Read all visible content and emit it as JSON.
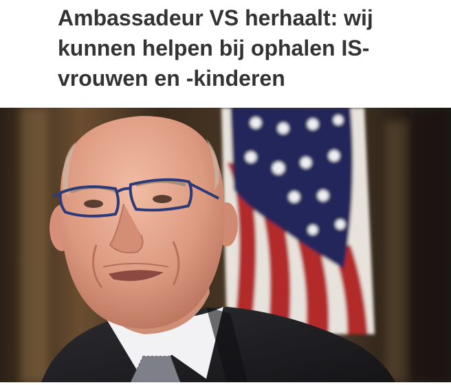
{
  "article": {
    "headline_lines": [
      "Ambassadeur VS herhaalt: wij",
      "kunnen helpen bij ophalen IS-",
      "vrouwen en -kinderen"
    ]
  },
  "photo": {
    "subject": "man-with-glasses-before-us-flag",
    "colors": {
      "background_dark": "#2e2418",
      "background_warm": "#7a5a38",
      "flag_blue": "#24285a",
      "flag_red": "#b32a2a",
      "flag_white": "#e8e2dc",
      "skin": "#e4a48c",
      "suit": "#222226",
      "shirt": "#f2f2f4"
    }
  }
}
